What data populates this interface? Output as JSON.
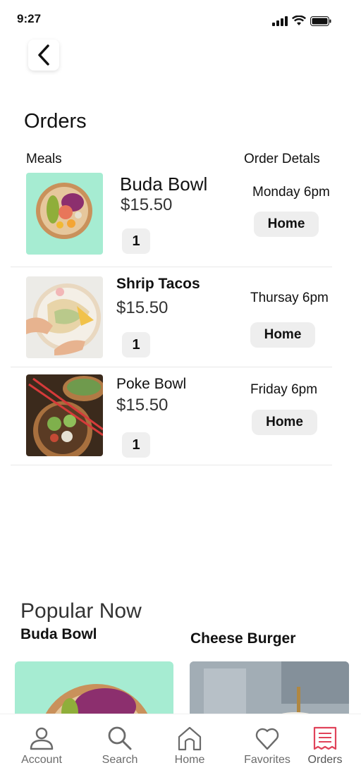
{
  "status_bar": {
    "time": "9:27"
  },
  "page": {
    "title": "Orders"
  },
  "columns": {
    "meals": "Meals",
    "details": "Order Detals"
  },
  "orders": [
    {
      "name": "Buda Bowl",
      "price": "$15.50",
      "qty": "1",
      "when": "Monday 6pm",
      "location": "Home"
    },
    {
      "name": "Shrip Tacos",
      "price": "$15.50",
      "qty": "1",
      "when": "Thursay 6pm",
      "location": "Home"
    },
    {
      "name": "Poke Bowl",
      "price": "$15.50",
      "qty": "1",
      "when": "Friday 6pm",
      "location": "Home"
    }
  ],
  "popular": {
    "title": "Popular Now",
    "items": [
      {
        "name": "Buda Bowl"
      },
      {
        "name": "Cheese Burger"
      }
    ]
  },
  "tabbar": {
    "active": "Orders",
    "accent_color": "#e0435a",
    "tabs": [
      {
        "label": "Account",
        "icon": "person-icon"
      },
      {
        "label": "Search",
        "icon": "search-icon"
      },
      {
        "label": "Home",
        "icon": "home-icon"
      },
      {
        "label": "Favorites",
        "icon": "heart-icon"
      },
      {
        "label": "Orders",
        "icon": "receipt-icon"
      }
    ]
  }
}
